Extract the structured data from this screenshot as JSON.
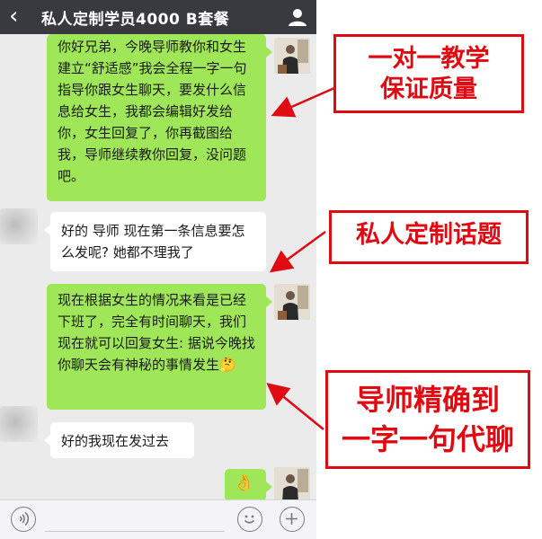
{
  "header": {
    "title": "私人定制学员4000 B套餐",
    "back_icon": "chevron-left-icon",
    "profile_icon": "person-icon"
  },
  "messages": [
    {
      "side": "right",
      "text": "你好兄弟，今晚导师教你和女生建立“舒适感”我会全程一字一句指导你跟女生聊天，要发什么信息给女生，我都会编辑好发给你，女生回复了，你再截图给我，导师继续教你回复，没问题吧。"
    },
    {
      "side": "left",
      "text": "好的 导师 现在第一条信息要怎么发呢? 她都不理我了"
    },
    {
      "side": "right",
      "text": "现在根据女生的情况来看是已经下班了，完全有时间聊天，我们现在就可以回复女生: 据说今晚找你聊天会有神秘的事情发生",
      "emoji": "🤔"
    },
    {
      "side": "left",
      "text": "好的我现在发过去"
    },
    {
      "side": "right",
      "text": "",
      "emoji": "👌"
    }
  ],
  "annotations": [
    {
      "text": "一对一教学\n保证质量"
    },
    {
      "text": "私人定制话题"
    },
    {
      "text": "导师精确到\n一字一句代聊"
    }
  ],
  "toolbar": {
    "voice_icon": "voice-icon",
    "emoji_icon": "smiley-icon",
    "plus_icon": "plus-icon"
  },
  "colors": {
    "header_bg": "#393a3f",
    "chat_bg": "#ebebeb",
    "sent_bubble": "#9fe658",
    "annotation_red": "#e00b12"
  }
}
